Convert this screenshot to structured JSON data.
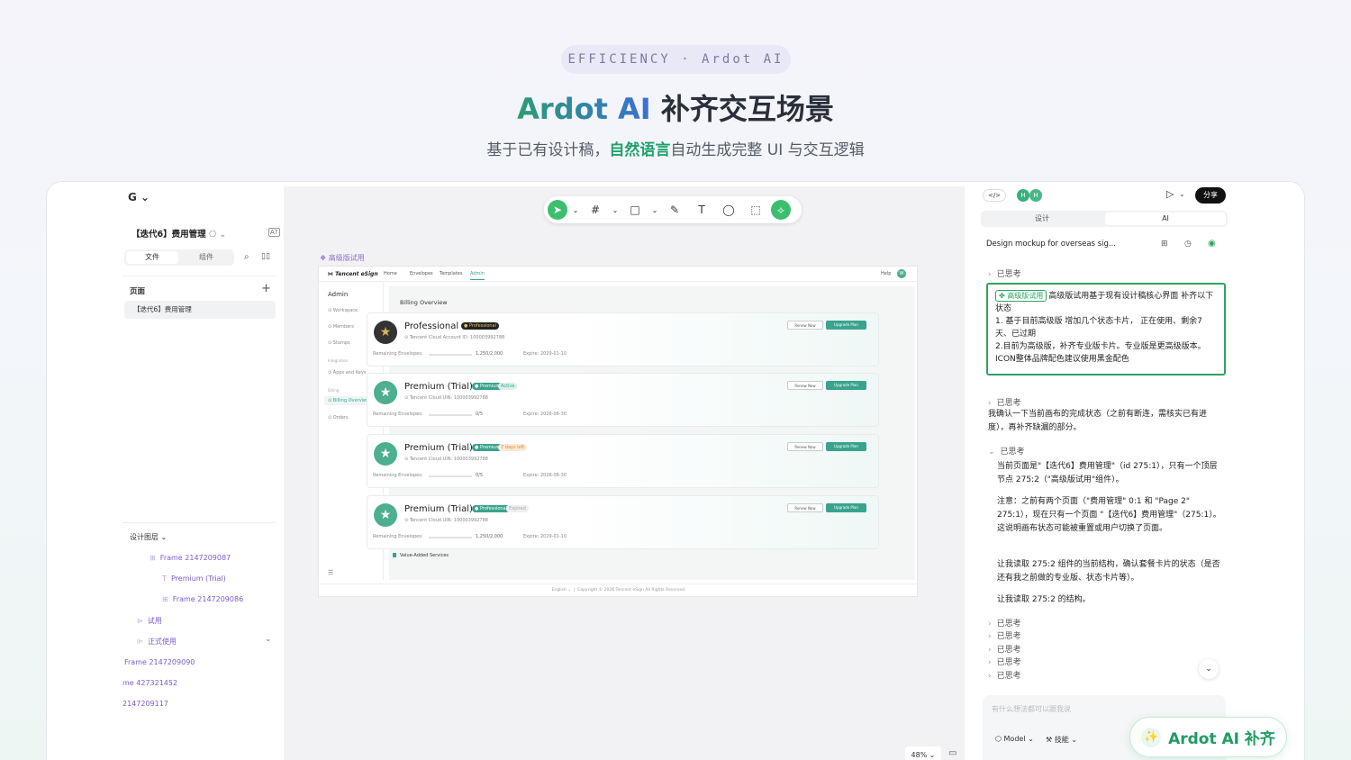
{
  "hero": {
    "pill": "EFFICIENCY · Ardot AI",
    "title_brand": "Ardot AI",
    "title_rest": " 补齐交互场景",
    "sub_a": "基于已有设计稿，",
    "sub_hl": "自然语言",
    "sub_b": "自动生成完整 UI 与交互逻辑"
  },
  "left": {
    "logo": "G",
    "project": "【迭代6】费用管理",
    "tab_files": "文件",
    "tab_components": "组件",
    "pages_label": "页面",
    "page_item": "【迭代6】费用管理",
    "layers_label": "设计图层",
    "layers": [
      "Frame 2147209087",
      "Premium (Trial)",
      "Frame 2147209086",
      "试用",
      "正式使用",
      "Frame 2147209090",
      "me 427321452",
      "2147209117"
    ]
  },
  "canvas": {
    "frame_label": "高级版试用",
    "zoom": "48%",
    "app": {
      "brand": "Tencent eSign",
      "nav": [
        "Home",
        "Envelopes",
        "Templates",
        "Admin"
      ],
      "help": "Help",
      "avatar": "W",
      "side_title": "Admin",
      "side_items": [
        "Workspace",
        "Members",
        "Stamps"
      ],
      "side_group1": "Integration",
      "side_item_api": "Apps and Keys",
      "side_group2": "Billing",
      "side_billing": "Billing Overview",
      "side_orders": "Orders",
      "section": "Billing Overview",
      "vas": "Value-Added Services",
      "footer_lang": "English",
      "footer_copy": "Copyright © 2026 Tencent eSign All Rights Reserved.",
      "cards": [
        {
          "name": "Professional",
          "badge": "Professional",
          "badge2": "",
          "acct": "Tencent Cloud Account ID: 100003992788",
          "rem_label": "Remaining Envelopes:",
          "rem": "1,250/2,000",
          "expire": "Expire: 2029-01-10",
          "renew": "Renew Now",
          "upgrade": "Upgrade Plan"
        },
        {
          "name": "Premium (Trial)",
          "badge": "Premium",
          "badge2": "Active",
          "acct": "Tencent Cloud UIN: 100003992788",
          "rem_label": "Remaining Envelopes:",
          "rem": "0/5",
          "expire": "Expire: 2026-06-30",
          "renew": "Renew Now",
          "upgrade": "Upgrade Plan"
        },
        {
          "name": "Premium (Trial)",
          "badge": "Premium",
          "badge2": "7 days left",
          "acct": "Tencent Cloud UIN: 100003992788",
          "rem_label": "Remaining Envelopes:",
          "rem": "0/5",
          "expire": "Expire: 2026-06-30",
          "renew": "Renew Now",
          "upgrade": "Upgrade Plan"
        },
        {
          "name": "Premium (Trial)",
          "badge": "Professional",
          "badge2": "Expired",
          "acct": "Tencent Cloud UIN: 100003992788",
          "rem_label": "Remaining Envelopes:",
          "rem": "1,250/2,000",
          "expire": "Expire: 2029-01-10",
          "renew": "Renew Now",
          "upgrade": "Upgrade Plan"
        }
      ]
    }
  },
  "right": {
    "code_icon": "</>",
    "avatar1": "H",
    "avatar2": "H",
    "share": "分享",
    "tab_design": "设计",
    "tab_ai": "AI",
    "chat_title": "Design mockup for overseas sig...",
    "think": "已思考",
    "card_tag": "高级版试用",
    "card_text": "高级版试用基于现有设计稿核心界面 补齐以下状态",
    "card_l1": "1. 基于目前高级版 增加几个状态卡片，  正在使用、剩余7天、已过期",
    "card_l2": "2.目前为高级版，补齐专业版卡片。专业版是更高级版本。ICON整体品牌配色建议使用黑金配色",
    "reply1": "我确认一下当前画布的完成状态（之前有断连，需核实已有进度），再补齐缺漏的部分。",
    "p1": "当前页面是\"【迭代6】费用管理\"（id 275:1），只有一个顶层节点 275:2（\"高级版试用\"组件）。",
    "p2": "注意：之前有两个页面（\"费用管理\" 0:1 和 \"Page 2\" 275:1），现在只有一个页面 \"【迭代6】费用管理\"（275:1）。这说明画布状态可能被重置或用户切换了页面。",
    "p3": "让我读取 275:2 组件的当前结构，确认套餐卡片的状态（是否还有我之前做的专业版、状态卡片等）。",
    "p4": "让我读取 275:2 的结构。",
    "input_placeholder": "有什么想法都可以跟我说",
    "model": "Model",
    "skill": "技能"
  },
  "floater": "Ardot AI 补齐"
}
